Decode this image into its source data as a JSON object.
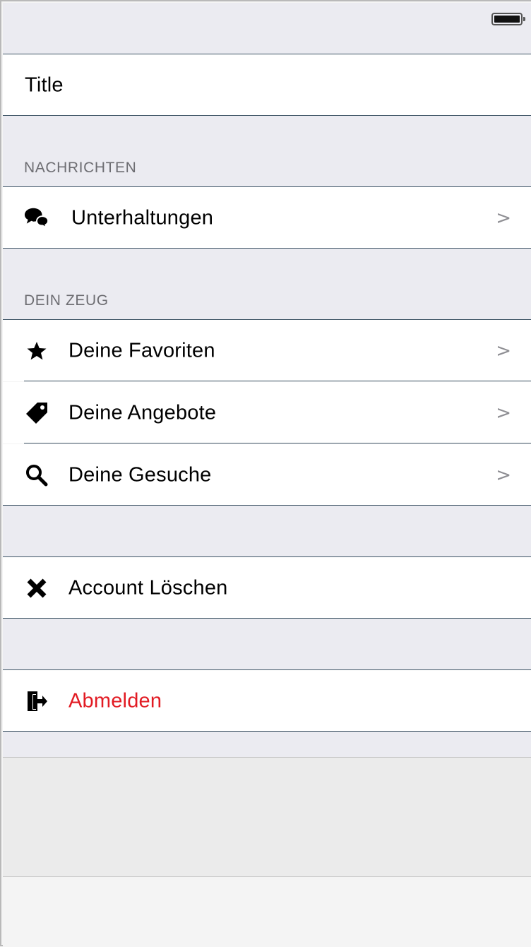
{
  "title_cell": {
    "label": "Title"
  },
  "sections": {
    "messages_header": "NACHRICHTEN",
    "stuff_header": "DEIN ZEUG"
  },
  "items": {
    "conversations": {
      "label": "Unterhaltungen",
      "icon": "chat-bubbles-icon",
      "chevron": ">"
    },
    "favorites": {
      "label": "Deine Favoriten",
      "icon": "star-icon",
      "chevron": ">"
    },
    "offers": {
      "label": "Deine Angebote",
      "icon": "tag-icon",
      "chevron": ">"
    },
    "requests": {
      "label": "Deine Gesuche",
      "icon": "search-icon",
      "chevron": ">"
    },
    "delete_account": {
      "label": "Account Löschen",
      "icon": "close-icon"
    },
    "logout": {
      "label": "Abmelden",
      "icon": "logout-icon",
      "color": "#e21b23"
    }
  },
  "colors": {
    "grouped_background": "#ebebf1",
    "separator": "#3f5566",
    "destructive": "#e21b23",
    "section_header_text": "#6d6d72",
    "chevron": "#8e8e93"
  }
}
